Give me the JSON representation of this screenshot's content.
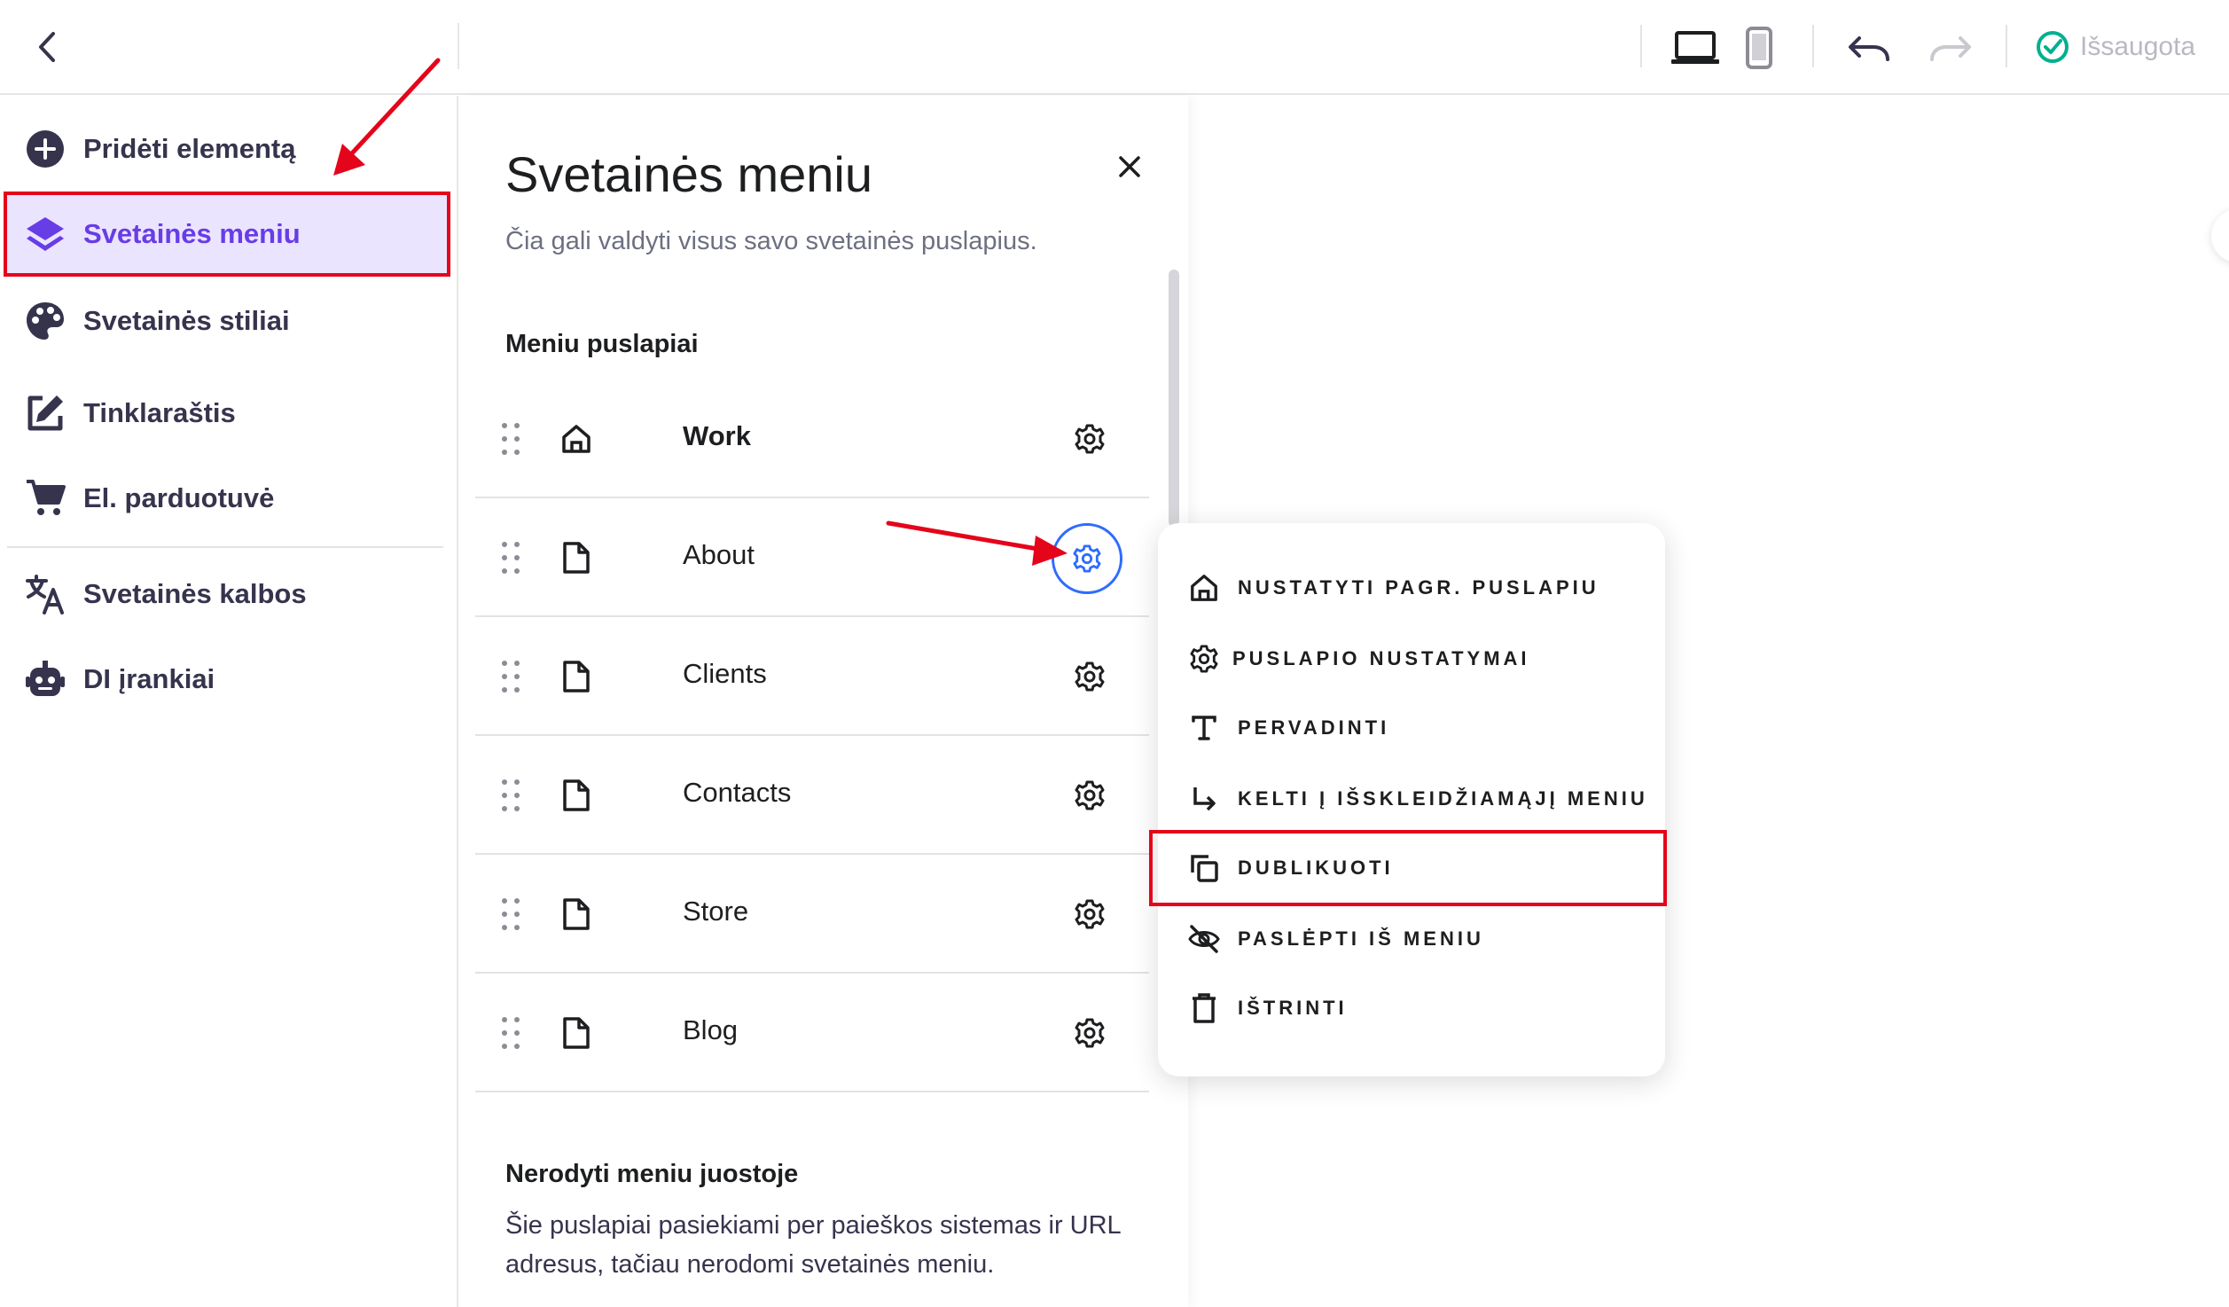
{
  "topbar": {
    "back_icon": "chevron-left-icon",
    "desktop_icon": "laptop-icon",
    "mobile_icon": "phone-icon",
    "undo_icon": "undo-icon",
    "redo_icon": "redo-icon",
    "saved_icon": "check-circle-icon",
    "saved_label": "Išsaugota",
    "saved_color": "#00b090"
  },
  "sidebar": {
    "items": [
      {
        "label": "Pridėti elementą",
        "icon": "plus-circle-icon"
      },
      {
        "label": "Svetainės meniu",
        "icon": "layers-icon",
        "active": true
      },
      {
        "label": "Svetainės stiliai",
        "icon": "palette-icon"
      },
      {
        "label": "Tinklaraštis",
        "icon": "edit-icon"
      },
      {
        "label": "El. parduotuvė",
        "icon": "cart-icon"
      },
      {
        "label": "Svetainės kalbos",
        "icon": "translate-icon"
      },
      {
        "label": "DI įrankiai",
        "icon": "robot-icon"
      }
    ]
  },
  "panel": {
    "title": "Svetainės meniu",
    "description": "Čia gali valdyti visus savo svetainės puslapius.",
    "menu_section_title": "Meniu puslapiai",
    "pages": [
      {
        "name": "Work",
        "icon": "home-icon",
        "bold": true
      },
      {
        "name": "About",
        "icon": "file-icon",
        "active": true
      },
      {
        "name": "Clients",
        "icon": "file-icon"
      },
      {
        "name": "Contacts",
        "icon": "file-icon"
      },
      {
        "name": "Store",
        "icon": "file-icon"
      },
      {
        "name": "Blog",
        "icon": "file-icon"
      }
    ],
    "hidden_section_title": "Nerodyti meniu juostoje",
    "hidden_description": "Šie puslapiai pasiekiami per paieškos sistemas ir URL adresus, tačiau nerodomi svetainės meniu."
  },
  "context_menu": {
    "items": [
      {
        "label": "NUSTATYTI PAGR. PUSLAPIU",
        "icon": "home-icon"
      },
      {
        "label": "PUSLAPIO NUSTATYMAI",
        "icon": "gear-icon"
      },
      {
        "label": "PERVADINTI",
        "icon": "text-icon"
      },
      {
        "label": "KELTI Į IŠSKLEIDŽIAMĄJĮ MENIU",
        "icon": "arrow-turn-down-right-icon"
      },
      {
        "label": "DUBLIKUOTI",
        "icon": "duplicate-icon",
        "highlight": true
      },
      {
        "label": "PASLĖPTI IŠ MENIU",
        "icon": "eye-off-icon"
      },
      {
        "label": "IŠTRINTI",
        "icon": "trash-icon"
      }
    ]
  },
  "colors": {
    "accent": "#673de6",
    "active_bg": "#ebe4ff",
    "annotation_red": "#e4051b",
    "focus_blue": "#2f6bff"
  }
}
